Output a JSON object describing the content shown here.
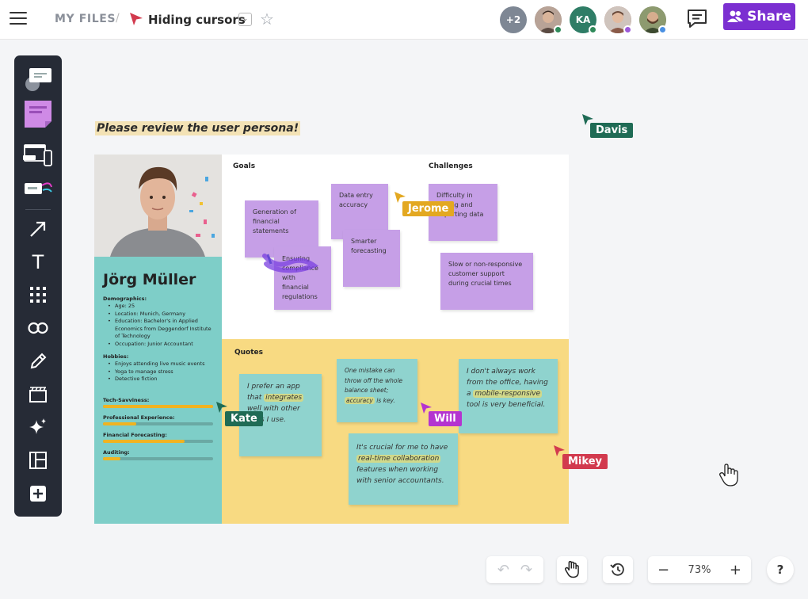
{
  "header": {
    "breadcrumb": "MY FILES",
    "separator": "/",
    "file_title": "Hiding cursors",
    "dropdown_glyph": "⌄",
    "star_glyph": "☆",
    "share_label": "Share",
    "avatars": [
      {
        "text": "+2",
        "bg": "#7e8794"
      },
      {
        "text": "",
        "bg": "#8a6a58",
        "status": "#2f8a5a"
      },
      {
        "text": "KA",
        "bg": "#2f7d66",
        "status": "#2f8a5a"
      },
      {
        "text": "",
        "bg": "#a07060",
        "status": "#9b59d9"
      },
      {
        "text": "",
        "bg": "#6b7a55",
        "status": "#4a90e2"
      }
    ]
  },
  "toolbar": {
    "tools": [
      "comment-icon",
      "sticky-note-icon",
      "devices-icon",
      "templates-icon",
      "arrow-icon",
      "text-icon",
      "grid-icon",
      "link-icon",
      "pencil-icon",
      "frame-icon",
      "magic-icon",
      "layout-icon",
      "add-icon"
    ],
    "text_glyph": "T"
  },
  "board": {
    "note": "Please review the user persona!",
    "persona": {
      "name": "Jörg Müller",
      "demographics_heading": "Demographics:",
      "demographics": [
        "Age: 25",
        "Location: Munich, Germany",
        "Education: Bachelor's in Applied Economics from Deggendorf Institute of Technology",
        "Occupation: Junior Accountant"
      ],
      "hobbies_heading": "Hobbies:",
      "hobbies": [
        "Enjoys attending live music events",
        "Yoga to manage stress",
        "Detective fiction"
      ],
      "skills": [
        {
          "label": "Tech-Savviness:",
          "value": 1.0
        },
        {
          "label": "Professional Experience:",
          "value": 0.3
        },
        {
          "label": "Financial Forecasting:",
          "value": 0.74
        },
        {
          "label": "Auditing:",
          "value": 0.16
        }
      ]
    },
    "goals_title": "Goals",
    "challenges_title": "Challenges",
    "quotes_title": "Quotes",
    "goals": [
      "Generation of financial statements",
      "Data entry accuracy",
      "Smarter forecasting",
      "Ensuring compliance with financial regulations"
    ],
    "challenges": [
      "Difficulty in sorting and importing data",
      "Slow or non-responsive customer support during crucial times"
    ],
    "quotes": {
      "q1": {
        "pre": "I prefer an app that ",
        "hl": "integrates",
        "post": " well with other tools I use."
      },
      "q2": {
        "pre": "One mistake can throw off the whole balance sheet; ",
        "hl": "accuracy",
        "post": " is key."
      },
      "q3": {
        "pre": "I don't always work from the office, having a ",
        "hl": "mobile-responsive",
        "post": " tool is very beneficial."
      },
      "q4": {
        "pre": "It's crucial for me to have ",
        "hl": "real-time collaboration",
        "post": " features when working with senior accountants."
      }
    }
  },
  "cursors": [
    {
      "name": "Davis",
      "color": "#1f6b55"
    },
    {
      "name": "Jerome",
      "color": "#e3a821"
    },
    {
      "name": "Kate",
      "color": "#1f6b55"
    },
    {
      "name": "Will",
      "color": "#b434d0"
    },
    {
      "name": "Mikey",
      "color": "#d23a4e"
    }
  ],
  "controls": {
    "undo": "↶",
    "redo": "↷",
    "zoom_out": "−",
    "zoom": "73%",
    "zoom_in": "+",
    "help": "?"
  }
}
